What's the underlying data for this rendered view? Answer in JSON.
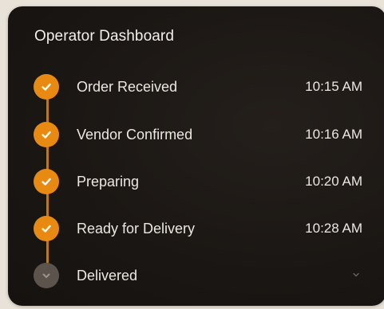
{
  "dashboard": {
    "title": "Operator Dashboard",
    "accent_color": "#e88a12",
    "steps": [
      {
        "label": "Order Received",
        "time": "10:15 AM",
        "status": "done",
        "icon": "check-icon"
      },
      {
        "label": "Vendor Confirmed",
        "time": "10:16 AM",
        "status": "done",
        "icon": "check-icon"
      },
      {
        "label": "Preparing",
        "time": "10:20 AM",
        "status": "done",
        "icon": "check-icon"
      },
      {
        "label": "Ready for Delivery",
        "time": "10:28 AM",
        "status": "done",
        "icon": "check-icon"
      },
      {
        "label": "Delivered",
        "time": "",
        "status": "pending",
        "icon": "chevron-down-icon"
      }
    ]
  }
}
